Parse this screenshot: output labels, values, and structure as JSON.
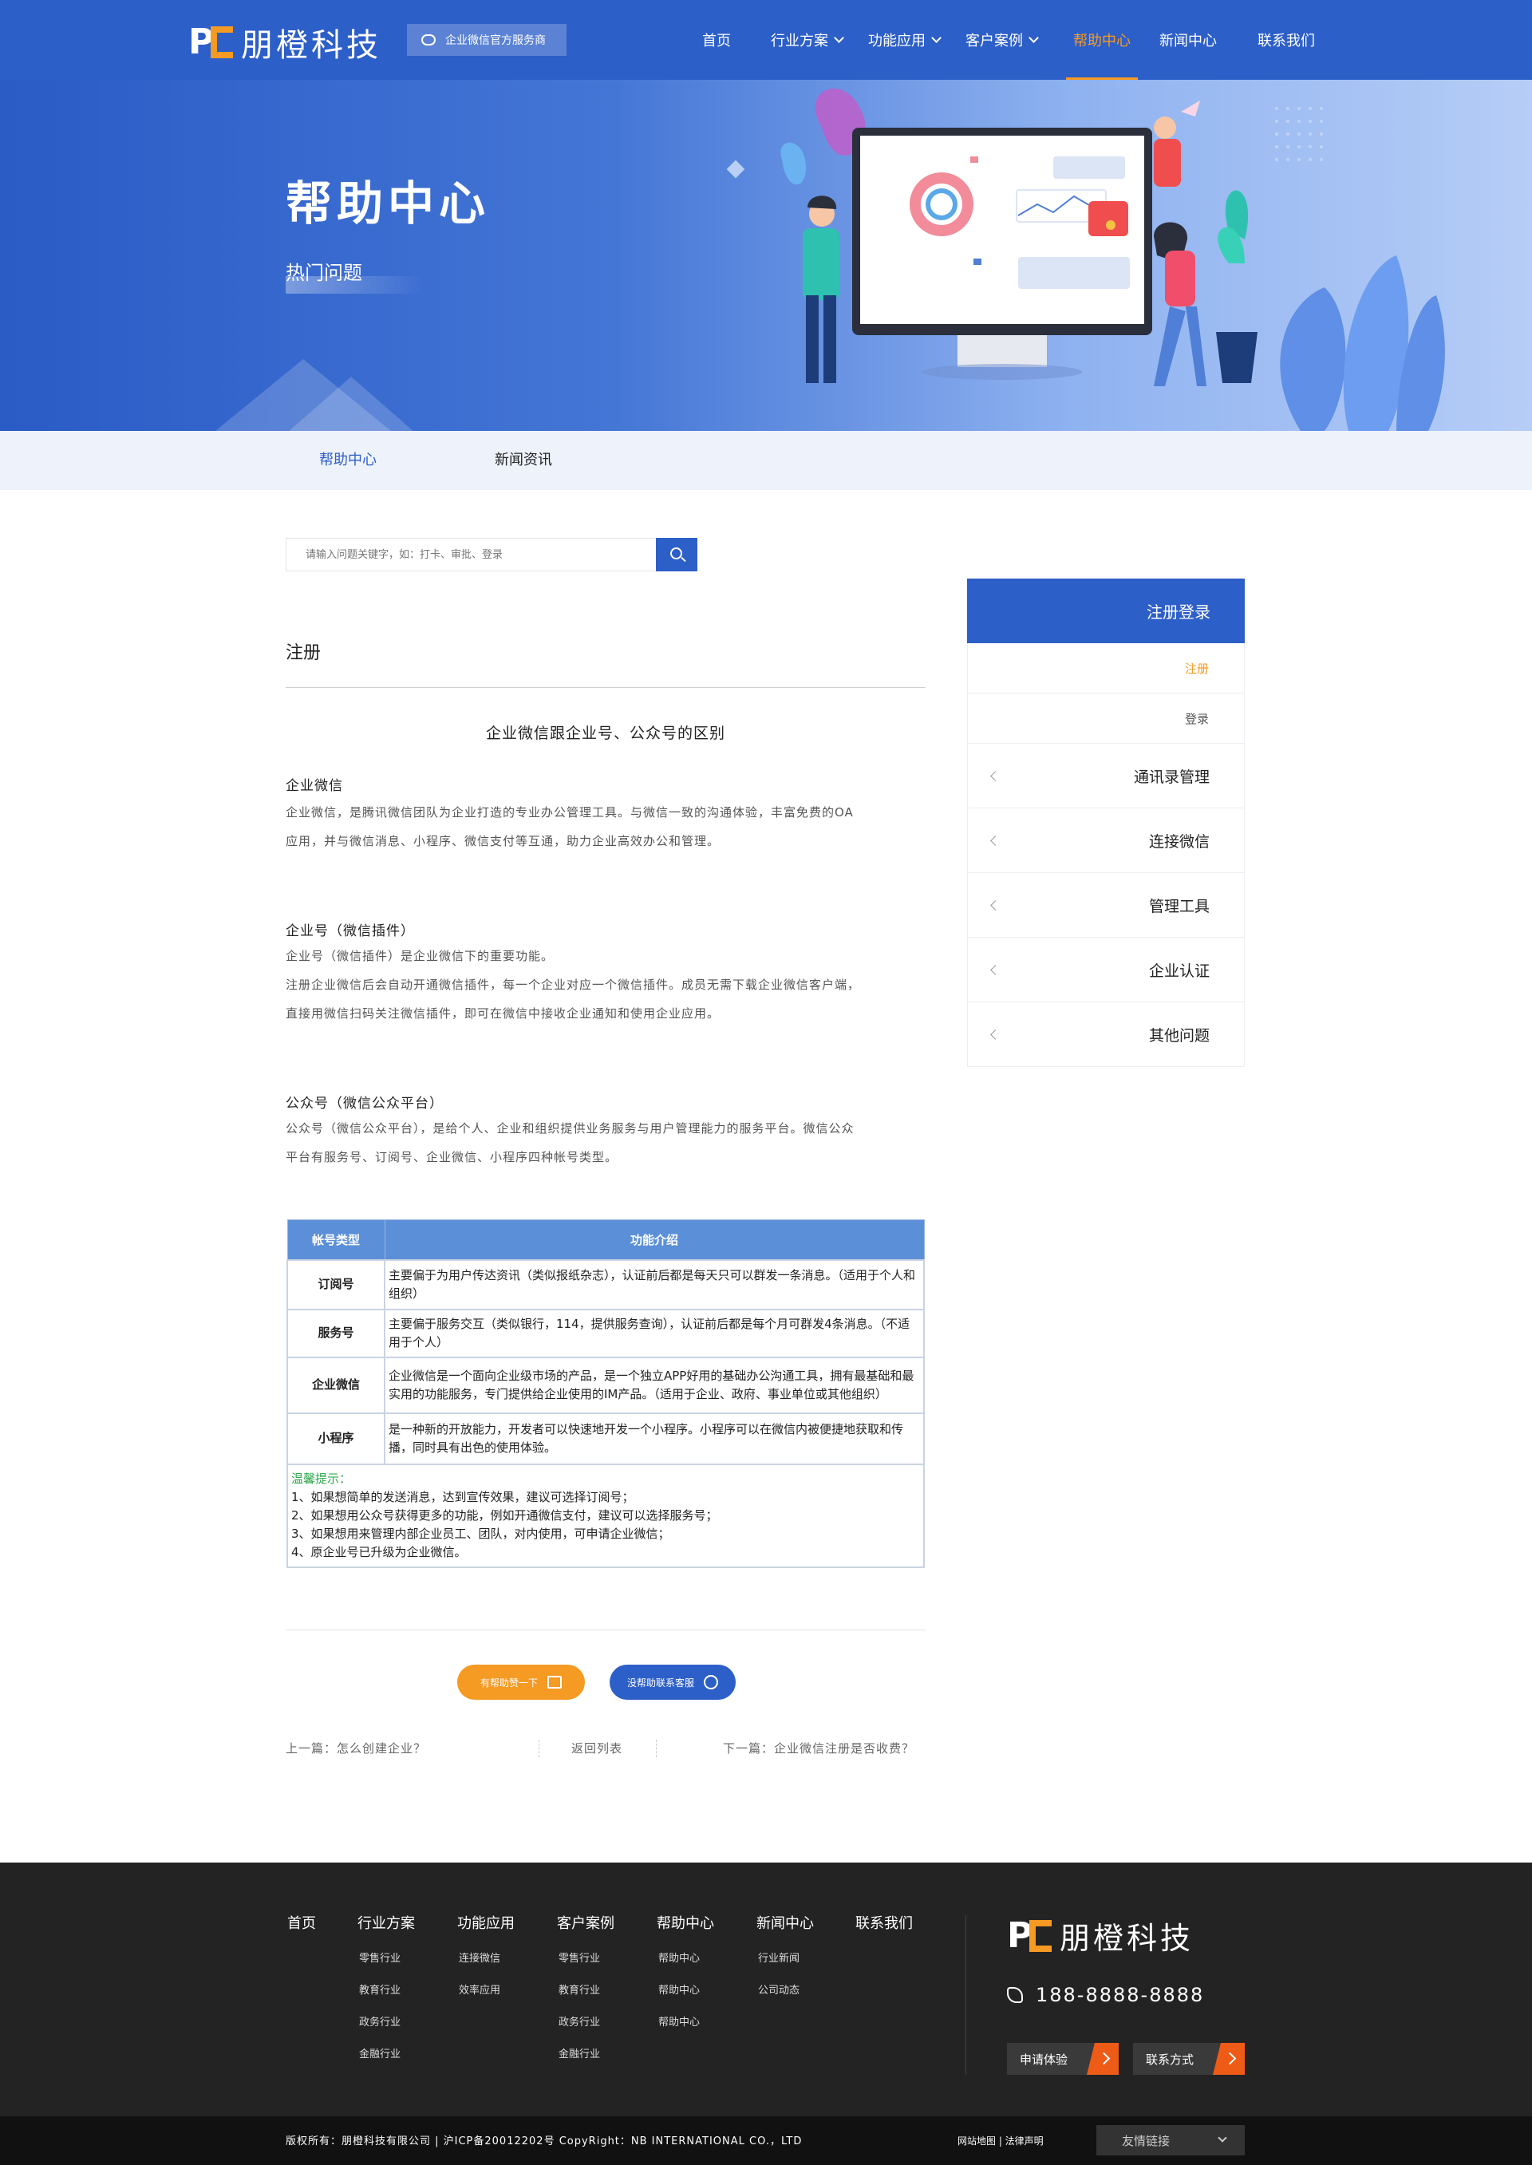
{
  "header": {
    "logo_letters": "PC",
    "logo_text": "朋橙科技",
    "badge": "企业微信官方服务商",
    "nav": [
      {
        "label": "首页",
        "has_dropdown": false,
        "active": false
      },
      {
        "label": "行业方案",
        "has_dropdown": true,
        "active": false
      },
      {
        "label": "功能应用",
        "has_dropdown": true,
        "active": false
      },
      {
        "label": "客户案例",
        "has_dropdown": true,
        "active": false
      },
      {
        "label": "帮助中心",
        "has_dropdown": false,
        "active": true
      },
      {
        "label": "新闻中心",
        "has_dropdown": false,
        "active": false
      },
      {
        "label": "联系我们",
        "has_dropdown": false,
        "active": false
      }
    ]
  },
  "banner": {
    "title": "帮助中心",
    "subtitle": "热门问题"
  },
  "subnav": {
    "items": [
      "帮助中心",
      "新闻资讯"
    ],
    "active_index": 0
  },
  "search": {
    "placeholder": "请输入问题关键字，如：打卡、审批、登录"
  },
  "article": {
    "section": "注册",
    "heading": "企业微信跟企业号、公众号的区别",
    "blocks": [
      {
        "title": "企业微信",
        "lines": [
          "企业微信，是腾讯微信团队为企业打造的专业办公管理工具。与微信一致的沟通体验，丰富免费的OA",
          "应用，并与微信消息、小程序、微信支付等互通，助力企业高效办公和管理。"
        ]
      },
      {
        "title": "企业号（微信插件）",
        "lines": [
          "企业号（微信插件）是企业微信下的重要功能。",
          "注册企业微信后会自动开通微信插件，每一个企业对应一个微信插件。成员无需下载企业微信客户端，",
          "直接用微信扫码关注微信插件，即可在微信中接收企业通知和使用企业应用。"
        ]
      },
      {
        "title": "公众号（微信公众平台）",
        "lines": [
          "公众号（微信公众平台），是给个人、企业和组织提供业务服务与用户管理能力的服务平台。微信公众",
          "平台有服务号、订阅号、企业微信、小程序四种帐号类型。"
        ]
      }
    ],
    "table": {
      "headers": [
        "帐号类型",
        "功能介绍"
      ],
      "rows": [
        {
          "type": "订阅号",
          "desc": "主要偏于为用户传达资讯（类似报纸杂志），认证前后都是每天只可以群发一条消息。（适用于个人和组织）"
        },
        {
          "type": "服务号",
          "desc": "主要偏于服务交互（类似银行，114，提供服务查询），认证前后都是每个月可群发4条消息。（不适用于个人）"
        },
        {
          "type": "企业微信",
          "desc": "企业微信是一个面向企业级市场的产品，是一个独立APP好用的基础办公沟通工具，拥有最基础和最实用的功能服务，专门提供给企业使用的IM产品。（适用于企业、政府、事业单位或其他组织）"
        },
        {
          "type": "小程序",
          "desc": "是一种新的开放能力，开发者可以快速地开发一个小程序。小程序可以在微信内被便捷地获取和传播，同时具有出色的使用体验。"
        }
      ],
      "note_title": "温馨提示：",
      "note_lines": [
        "1、如果想简单的发送消息，达到宣传效果，建议可选择订阅号；",
        "2、如果想用公众号获得更多的功能，例如开通微信支付，建议可以选择服务号；",
        "3、如果想用来管理内部企业员工、团队，对内使用，可申请企业微信；",
        "4、原企业号已升级为企业微信。"
      ]
    },
    "like_button": "有帮助赞一下",
    "cs_button": "没帮助联系客服",
    "prev": "上一篇：怎么创建企业？",
    "back": "返回列表",
    "next": "下一篇：企业微信注册是否收费？"
  },
  "sidebar": {
    "head": "注册登录",
    "subs": [
      {
        "label": "注册",
        "active": true
      },
      {
        "label": "登录",
        "active": false
      }
    ],
    "cats": [
      "通讯录管理",
      "连接微信",
      "管理工具",
      "企业认证",
      "其他问题"
    ]
  },
  "footer": {
    "columns": [
      {
        "title": "首页",
        "links": []
      },
      {
        "title": "行业方案",
        "links": [
          "零售行业",
          "教育行业",
          "政务行业",
          "金融行业"
        ]
      },
      {
        "title": "功能应用",
        "links": [
          "连接微信",
          "效率应用"
        ]
      },
      {
        "title": "客户案例",
        "links": [
          "零售行业",
          "教育行业",
          "政务行业",
          "金融行业"
        ]
      },
      {
        "title": "帮助中心",
        "links": [
          "帮助中心",
          "帮助中心",
          "帮助中心"
        ]
      },
      {
        "title": "新闻中心",
        "links": [
          "行业新闻",
          "公司动态"
        ]
      },
      {
        "title": "联系我们",
        "links": []
      }
    ],
    "logo_letters": "PC",
    "logo_text": "朋橙科技",
    "phone": "188-8888-8888",
    "btn_trial": "申请体验",
    "btn_contact": "联系方式"
  },
  "copyright": {
    "text": "版权所有：朋橙科技有限公司 | 沪ICP备20012202号  CopyRight：NB INTERNATIONAL CO.，LTD",
    "links": "网站地图  |  法律声明",
    "friend_links": "友情链接"
  },
  "colors": {
    "brand_blue": "#2d5fc8",
    "accent_orange": "#f59a23",
    "footer_bg": "#232323",
    "cta_orange": "#ee5b17"
  }
}
